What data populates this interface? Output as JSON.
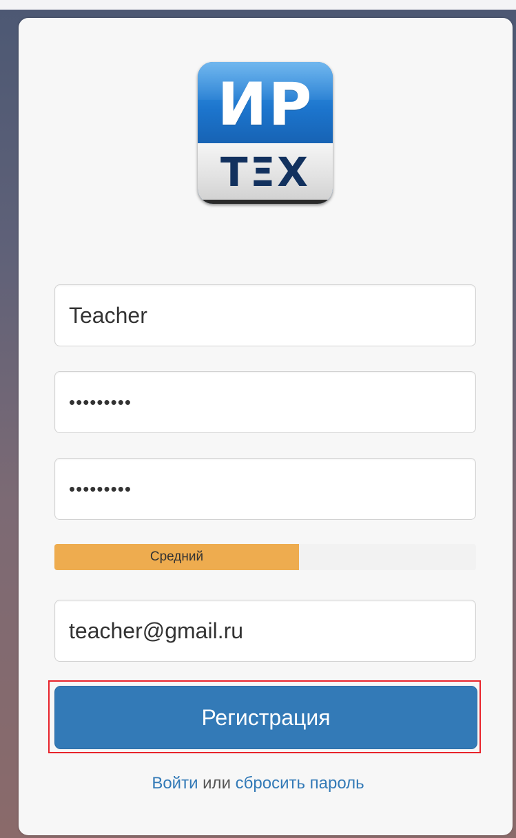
{
  "logo": {
    "top_text": "ИР",
    "bottom_text": "ТΞХ"
  },
  "form": {
    "username_value": "Teacher",
    "password_value": "•••••••••",
    "password_confirm_value": "•••••••••",
    "strength": {
      "label": "Средний",
      "level_fraction": 0.58,
      "color": "#eeac4f"
    },
    "email_value": "teacher@gmail.ru"
  },
  "register_button": {
    "label": "Регистрация",
    "color": "#337ab7",
    "highlight_color": "#e8232b"
  },
  "footer": {
    "login_link": "Войти",
    "separator": " или ",
    "reset_link": "сбросить пароль"
  }
}
